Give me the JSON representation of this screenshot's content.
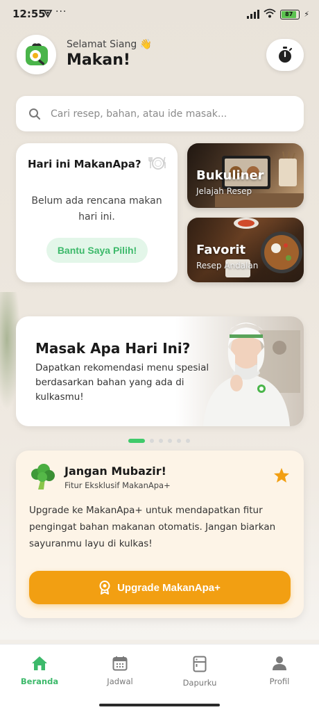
{
  "status_bar": {
    "time": "12:55",
    "dots": "···",
    "battery": "87"
  },
  "header": {
    "greeting": "Selamat Siang 👋",
    "app_title": "Makan!"
  },
  "search": {
    "placeholder": "Cari resep, bahan, atau ide masak..."
  },
  "today_card": {
    "title": "Hari ini MakanApa?",
    "message": "Belum ada rencana makan hari ini.",
    "button_label": "Bantu Saya Pilih!"
  },
  "tiles": [
    {
      "title": "Bukuliner",
      "subtitle": "Jelajah Resep"
    },
    {
      "title": "Favorit",
      "subtitle": "Resep Andalan"
    }
  ],
  "banner": {
    "title": "Masak Apa Hari Ini?",
    "text": "Dapatkan rekomendasi menu spesial berdasarkan bahan yang ada di kulkasmu!"
  },
  "carousel": {
    "count": 6,
    "active_index": 0
  },
  "upgrade_card": {
    "title": "Jangan Mubazir!",
    "subtitle": "Fitur Eksklusif MakanApa+",
    "text": "Upgrade ke MakanApa+ untuk mendapatkan fitur pengingat bahan makanan otomatis. Jangan biarkan sayuranmu layu di kulkas!",
    "button_label": "Upgrade MakanApa+"
  },
  "bottom_nav": {
    "items": [
      {
        "label": "Beranda",
        "icon": "home-icon",
        "active": true
      },
      {
        "label": "Jadwal",
        "icon": "calendar-icon",
        "active": false
      },
      {
        "label": "Dapurku",
        "icon": "fridge-icon",
        "active": false
      },
      {
        "label": "Profil",
        "icon": "person-icon",
        "active": false
      }
    ]
  },
  "colors": {
    "accent_green": "#3cb96a",
    "accent_orange": "#f29f12",
    "upgrade_bg": "#fdf4e7"
  }
}
